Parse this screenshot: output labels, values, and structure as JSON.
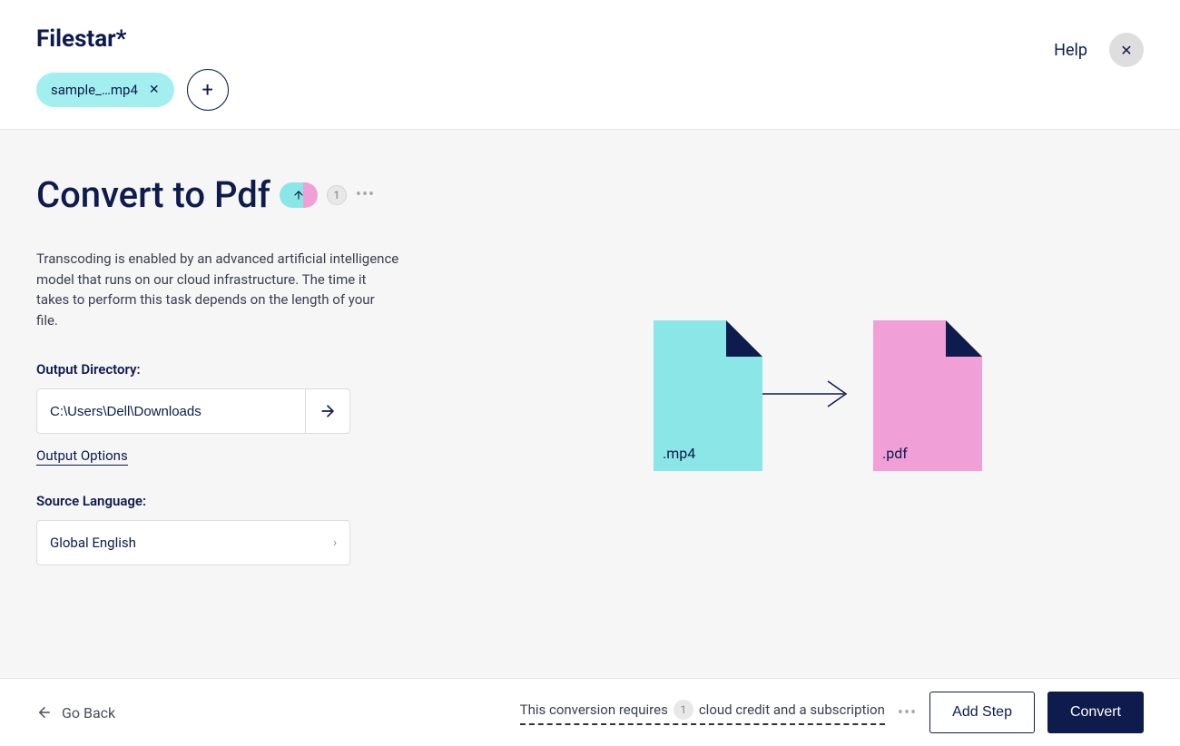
{
  "header": {
    "logo": "Filestar*",
    "file_chip": "sample_…mp4",
    "help_label": "Help"
  },
  "main": {
    "title": "Convert to Pdf",
    "count": "1",
    "description": "Transcoding is enabled by an advanced artificial intelligence model that runs on our cloud infrastructure. The time it takes to perform this task depends on the length of your file.",
    "output_dir_label": "Output Directory:",
    "output_dir_value": "C:\\Users\\Dell\\Downloads",
    "output_options": "Output Options",
    "source_lang_label": "Source Language:",
    "source_lang_value": "Global English",
    "diagram": {
      "source_ext": ".mp4",
      "target_ext": ".pdf"
    }
  },
  "footer": {
    "go_back": "Go Back",
    "credit_text_pre": "This conversion requires",
    "credit_count": "1",
    "credit_text_post": "cloud credit and a subscription",
    "add_step": "Add Step",
    "convert": "Convert"
  }
}
